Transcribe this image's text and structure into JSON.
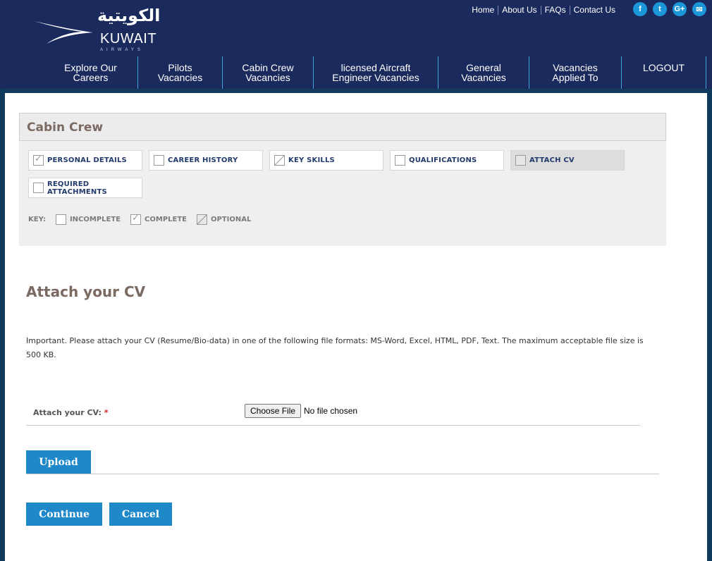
{
  "header": {
    "logo_text": "KUWAIT",
    "logo_sub": "AIRWAYS",
    "logo_arabic": "الكويتية",
    "top_links": [
      "Home",
      "About Us",
      "FAQs",
      "Contact Us"
    ],
    "social": [
      {
        "name": "facebook-icon",
        "glyph": "f"
      },
      {
        "name": "twitter-icon",
        "glyph": "t"
      },
      {
        "name": "google-plus-icon",
        "glyph": "G+"
      },
      {
        "name": "email-icon",
        "glyph": "✉"
      }
    ]
  },
  "nav": [
    {
      "line1": "Explore Our",
      "line2": "Careers"
    },
    {
      "line1": "Pilots",
      "line2": "Vacancies"
    },
    {
      "line1": "Cabin Crew",
      "line2": "Vacancies"
    },
    {
      "line1": "licensed Aircraft",
      "line2": "Engineer Vacancies"
    },
    {
      "line1": "General",
      "line2": "Vacancies"
    },
    {
      "line1": "Vacancies",
      "line2": "Applied To"
    },
    {
      "line1": "LOGOUT",
      "line2": ""
    }
  ],
  "panel": {
    "heading": "Cabin Crew",
    "steps": [
      {
        "label": "PERSONAL DETAILS",
        "state": "complete"
      },
      {
        "label": "CAREER HISTORY",
        "state": "incomplete"
      },
      {
        "label": "KEY SKILLS",
        "state": "optional"
      },
      {
        "label": "QUALIFICATIONS",
        "state": "incomplete"
      },
      {
        "label": "ATTACH CV",
        "state": "incomplete",
        "active": true
      },
      {
        "label": "REQUIRED ATTACHMENTS",
        "state": "incomplete"
      }
    ],
    "key_label": "KEY:",
    "key": [
      "INCOMPLETE",
      "COMPLETE",
      "OPTIONAL"
    ]
  },
  "main": {
    "title": "Attach your CV",
    "info": "Important. Please attach your CV (Resume/Bio-data) in one of the following file formats: MS-Word, Excel, HTML, PDF, Text. The maximum acceptable file size is 500 KB.",
    "field_label": "Attach your CV:",
    "required_mark": "*",
    "choose_file": "Choose File",
    "file_status": "No file chosen",
    "upload": "Upload",
    "continue": "Continue",
    "cancel": "Cancel"
  },
  "colors": {
    "brand_navy": "#1b2a5c",
    "accent_blue": "#1f88c9",
    "heading_brown": "#7a6a62"
  }
}
